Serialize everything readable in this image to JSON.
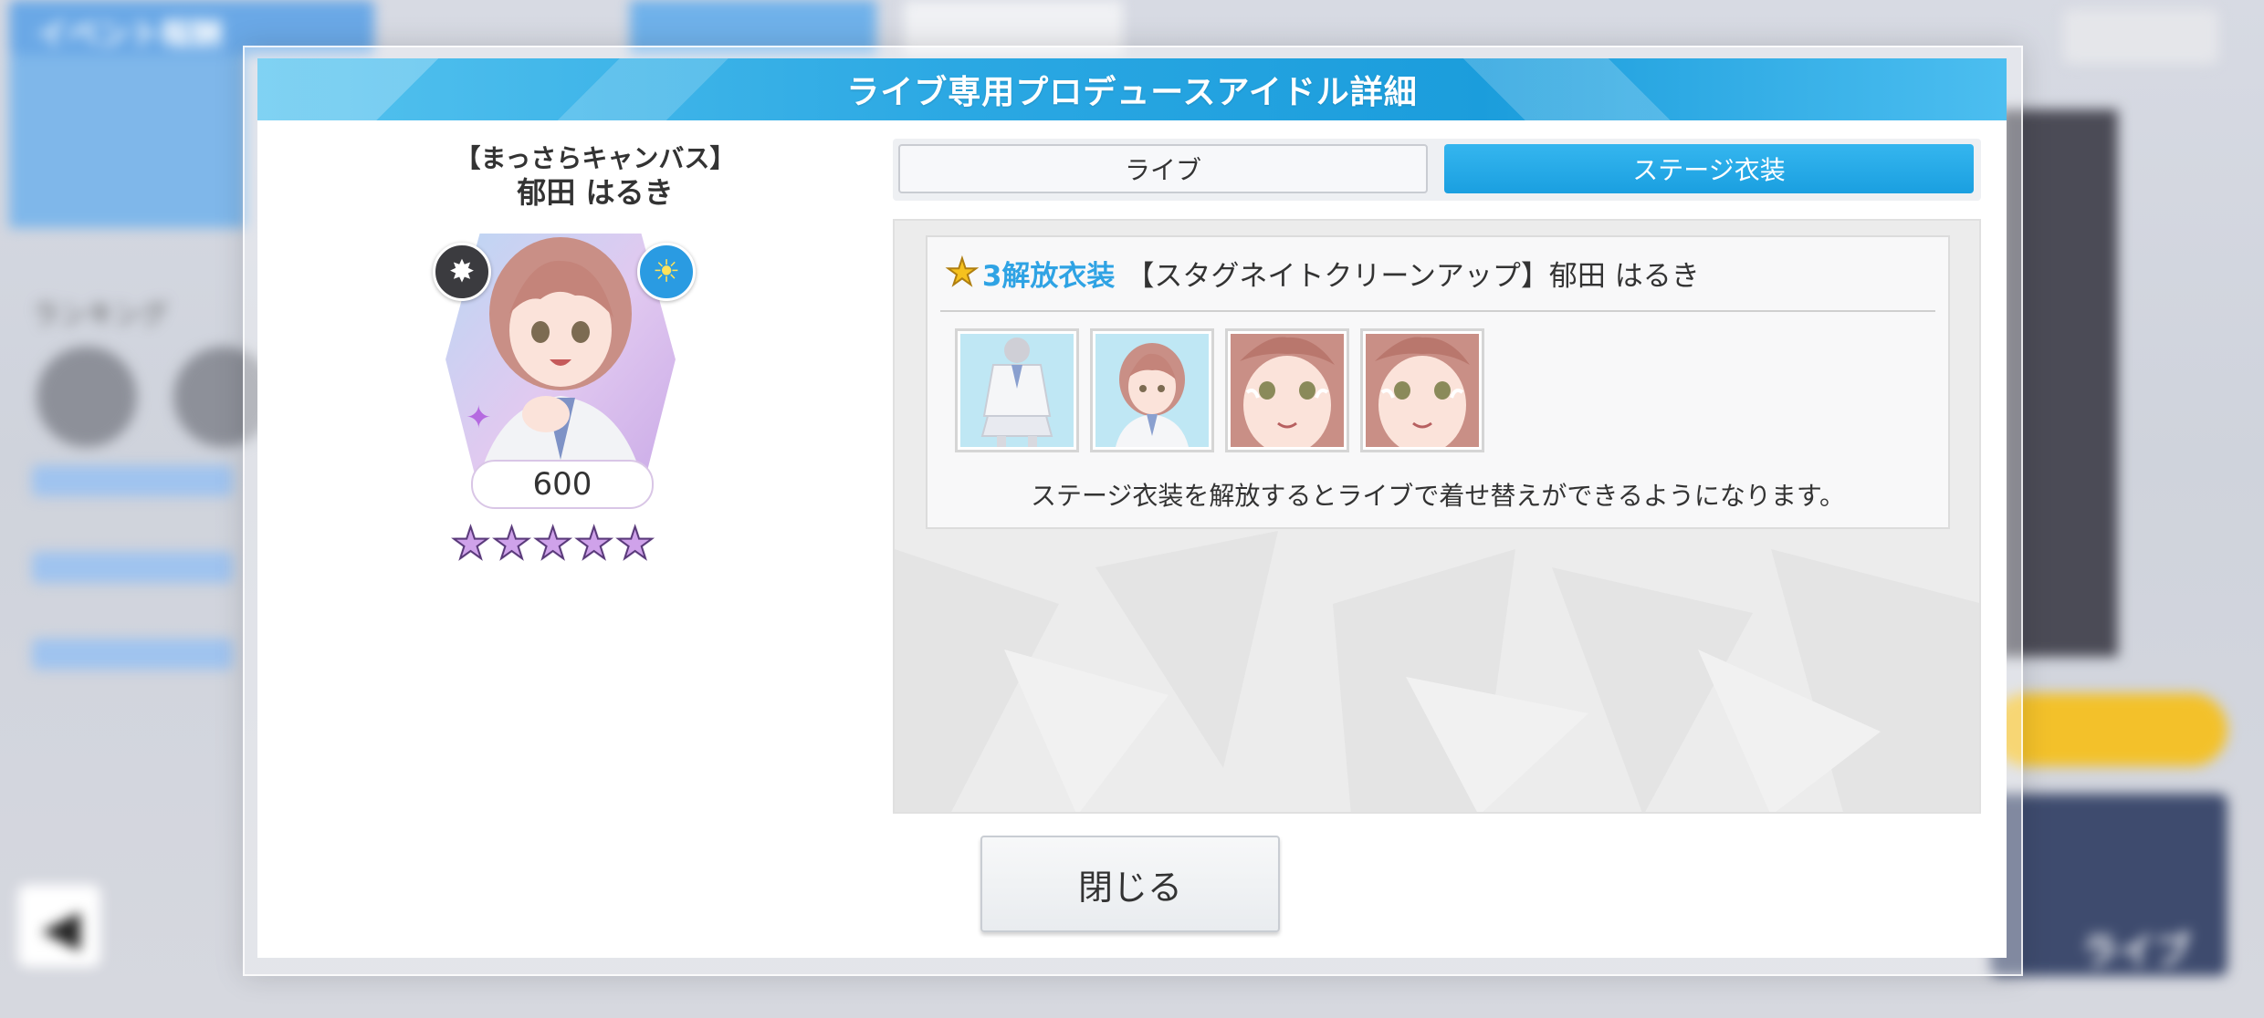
{
  "background": {
    "event_header": "イベント報酬",
    "ranking_label": "ランキング",
    "live_button": "ライブ"
  },
  "dialog": {
    "title": "ライブ専用プロデュースアイドル詳細",
    "close_label": "閉じる"
  },
  "idol": {
    "card_title": "【まっさらキャンバス】",
    "name": "郁田 はるき",
    "score": "600",
    "star_rating": 5,
    "star_max": 5
  },
  "tabs": [
    {
      "label": "ライブ",
      "selected": false
    },
    {
      "label": "ステージ衣装",
      "selected": true
    }
  ],
  "costume": {
    "unlock_level": "3解放衣装",
    "name": "【スタグネイトクリーンアップ】郁田 はるき",
    "note": "ステージ衣装を解放するとライブで着せ替えができるようになります。",
    "thumbnails": [
      "full-body",
      "bust",
      "face-smile",
      "face-smile"
    ]
  },
  "colors": {
    "accent_blue": "#1b9ddc",
    "costume_level_blue": "#2fa3e4",
    "star_gold": "#f6c21e"
  }
}
